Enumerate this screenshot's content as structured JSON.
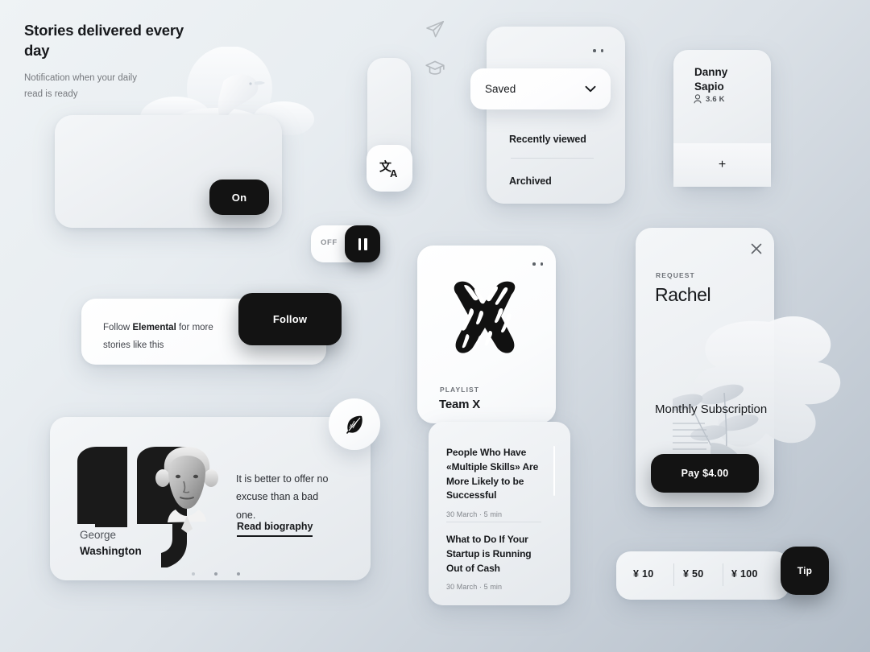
{
  "background": {
    "from": "#eff3f5",
    "to": "#b4bec9"
  },
  "accent": {
    "black": "#131313",
    "text": "#16181b",
    "muted": "#76797e"
  },
  "notification": {
    "title": "Stories delivered every day",
    "subtitle": "Notification when your daily read is ready",
    "toggle_label": "On",
    "decor_icon": "bird-cloud-illustration"
  },
  "icon_rail": {
    "icons": [
      {
        "name": "send-icon",
        "state": "inactive"
      },
      {
        "name": "graduation-cap-icon",
        "state": "inactive"
      }
    ],
    "active": {
      "name": "translate-icon",
      "glyph": "文A"
    }
  },
  "dropdown": {
    "selected": "Saved",
    "chevron": "chevron-down-icon",
    "options": [
      "Recently viewed",
      "Archived"
    ],
    "menu_dots": "more-dots-icon"
  },
  "profile": {
    "name": "Danny Sapio",
    "followers_icon": "person-icon",
    "followers": "3.6 K",
    "add_label": "+"
  },
  "toggle": {
    "label": "OFF",
    "knob_icon": "pause-icon"
  },
  "follow": {
    "text_before": "Follow ",
    "brand": "Elemental",
    "text_after": " for more stories like this",
    "button_label": "Follow"
  },
  "quote": {
    "author_first": "George",
    "author_last": "Washington",
    "text": "It is better to offer no excuse than a bad one.",
    "link_label": "Read biography",
    "badge_icon": "feather-icon",
    "quote_mark_icon": "quotation-mark-glyph",
    "portrait_alt": "george-washington-portrait",
    "pagination_dots": 3
  },
  "playlist": {
    "kicker": "PLAYLIST",
    "title": "Team X",
    "artwork_icon": "letter-x-artwork",
    "menu_dots": "more-dots-icon"
  },
  "articles": [
    {
      "title": "People Who Have «Multiple Skills» Are More Likely to be Successful",
      "meta": "30 March ·  5 min"
    },
    {
      "title": "What to Do If Your Startup is Running Out of Cash",
      "meta": "30 March ·  5 min"
    }
  ],
  "request": {
    "kicker": "REQUEST",
    "name": "Rachel",
    "close_icon": "close-icon",
    "plan": "Monthly Subscription",
    "pay_label": "Pay $4.00",
    "decor_icon": "plant-leaves-illustration"
  },
  "tip": {
    "amounts": [
      "¥ 10",
      "¥ 50",
      "¥ 100"
    ],
    "button_label": "Tip"
  }
}
